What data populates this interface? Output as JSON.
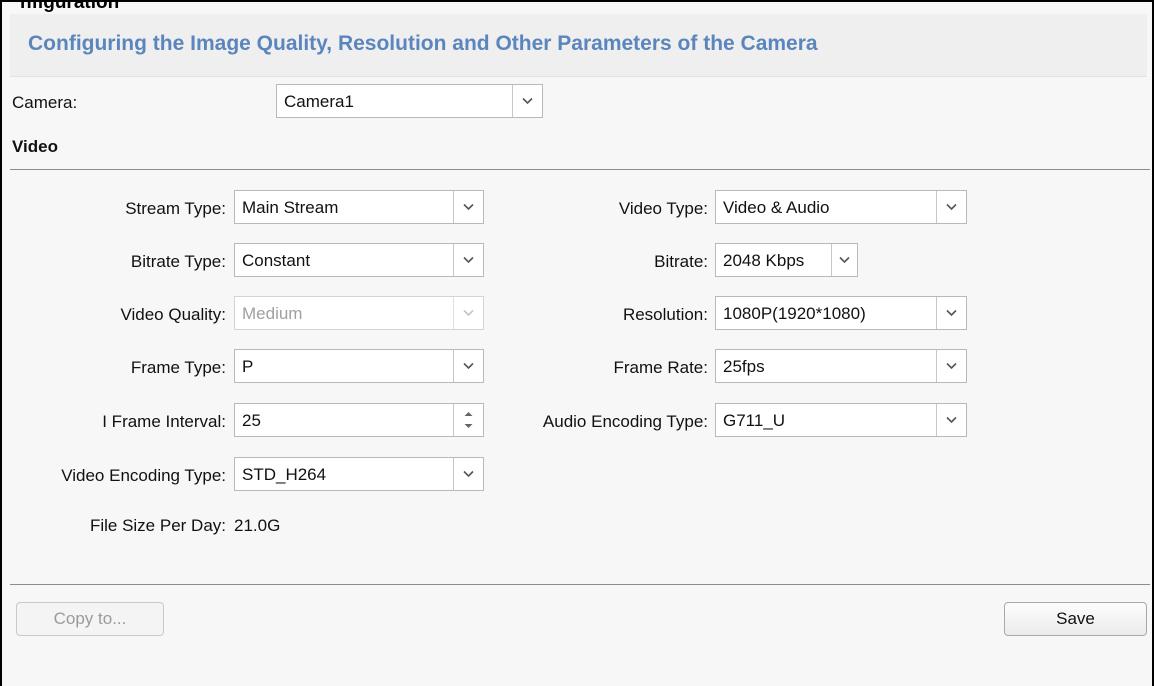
{
  "page": {
    "top_caption": "nfiguration",
    "title": "Configuring the Image Quality, Resolution and Other Parameters of the Camera"
  },
  "camera": {
    "label": "Camera:",
    "value": "Camera1"
  },
  "section": {
    "video_title": "Video"
  },
  "fields": {
    "stream_type": {
      "label": "Stream Type:",
      "value": "Main Stream"
    },
    "bitrate_type": {
      "label": "Bitrate Type:",
      "value": "Constant"
    },
    "video_quality": {
      "label": "Video Quality:",
      "value": "Medium"
    },
    "frame_type": {
      "label": "Frame Type:",
      "value": "P"
    },
    "i_frame_interval": {
      "label": "I Frame Interval:",
      "value": "25"
    },
    "video_encoding_type": {
      "label": "Video Encoding Type:",
      "value": "STD_H264"
    },
    "file_size_per_day": {
      "label": "File Size Per Day:",
      "value": "21.0G"
    },
    "video_type": {
      "label": "Video Type:",
      "value": "Video & Audio"
    },
    "bitrate": {
      "label": "Bitrate:",
      "value": "2048 Kbps"
    },
    "resolution": {
      "label": "Resolution:",
      "value": "1080P(1920*1080)"
    },
    "frame_rate": {
      "label": "Frame Rate:",
      "value": "25fps"
    },
    "audio_encoding_type": {
      "label": "Audio Encoding Type:",
      "value": "G711_U"
    }
  },
  "buttons": {
    "copy_to": "Copy to...",
    "save": "Save"
  },
  "colors": {
    "title_blue": "#5b86bd",
    "disabled_text": "#a0a0a0"
  },
  "icons": {
    "dropdown": "chevron-down-icon",
    "spinner": "spinner-arrows-icon"
  }
}
